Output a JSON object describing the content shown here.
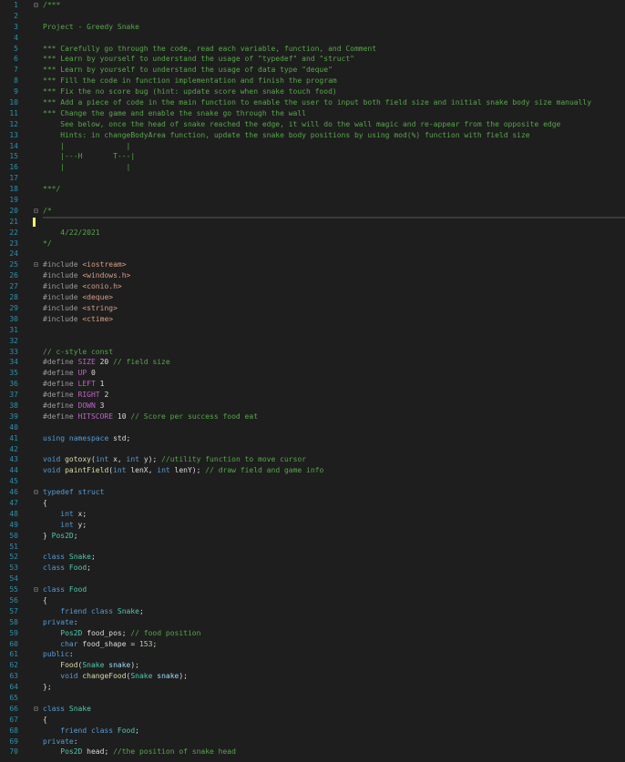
{
  "lines": [
    {
      "n": "1",
      "fold": "⊟",
      "tokens": [
        [
          "/***",
          "comment"
        ]
      ]
    },
    {
      "n": "2",
      "fold": "",
      "tokens": []
    },
    {
      "n": "3",
      "fold": "",
      "tokens": [
        [
          "Project - Greedy Snake",
          "comment"
        ]
      ]
    },
    {
      "n": "4",
      "fold": "",
      "tokens": []
    },
    {
      "n": "5",
      "fold": "",
      "tokens": [
        [
          "*** Carefully go through the code, read each variable, function, and Comment",
          "comment"
        ]
      ]
    },
    {
      "n": "6",
      "fold": "",
      "tokens": [
        [
          "*** Learn by yourself to understand the usage of \"typedef\" and \"struct\"",
          "comment"
        ]
      ]
    },
    {
      "n": "7",
      "fold": "",
      "tokens": [
        [
          "*** Learn by yourself to understand the usage of data type \"deque\"",
          "comment"
        ]
      ]
    },
    {
      "n": "8",
      "fold": "",
      "tokens": [
        [
          "*** Fill the code in function implementation and finish the program",
          "comment"
        ]
      ]
    },
    {
      "n": "9",
      "fold": "",
      "tokens": [
        [
          "*** Fix the no score bug (hint: update score when snake touch food)",
          "comment"
        ]
      ]
    },
    {
      "n": "10",
      "fold": "",
      "tokens": [
        [
          "*** Add a piece of code in the main function to enable the user to input both field size and initial snake body size manually",
          "comment"
        ]
      ]
    },
    {
      "n": "11",
      "fold": "",
      "tokens": [
        [
          "*** Change the game and enable the snake go through the wall",
          "comment"
        ]
      ]
    },
    {
      "n": "12",
      "fold": "",
      "tokens": [
        [
          "    See below, once the head of snake reached the edge, it will do the wall magic and re-appear from the opposite edge",
          "comment"
        ]
      ]
    },
    {
      "n": "13",
      "fold": "",
      "tokens": [
        [
          "    Hints: in changeBodyArea function, update the snake body positions by using mod(%) function with field size",
          "comment"
        ]
      ]
    },
    {
      "n": "14",
      "fold": "",
      "tokens": [
        [
          "    |              |",
          "comment"
        ]
      ]
    },
    {
      "n": "15",
      "fold": "",
      "tokens": [
        [
          "    |---H       T---|",
          "comment"
        ]
      ]
    },
    {
      "n": "16",
      "fold": "",
      "tokens": [
        [
          "    |              |",
          "comment"
        ]
      ]
    },
    {
      "n": "17",
      "fold": "",
      "tokens": []
    },
    {
      "n": "18",
      "fold": "",
      "tokens": [
        [
          "***/",
          "comment"
        ]
      ]
    },
    {
      "n": "19",
      "fold": "",
      "tokens": []
    },
    {
      "n": "20",
      "fold": "⊟",
      "tokens": [
        [
          "/*",
          "comment"
        ]
      ]
    },
    {
      "n": "21",
      "fold": "",
      "tokens": [],
      "current": true
    },
    {
      "n": "22",
      "fold": "",
      "tokens": [
        [
          "    4/22/2021",
          "comment"
        ]
      ]
    },
    {
      "n": "23",
      "fold": "",
      "tokens": [
        [
          "*/",
          "comment"
        ]
      ]
    },
    {
      "n": "24",
      "fold": "",
      "tokens": []
    },
    {
      "n": "25",
      "fold": "⊟",
      "tokens": [
        [
          "#include ",
          "pp"
        ],
        [
          "<iostream>",
          "string"
        ]
      ]
    },
    {
      "n": "26",
      "fold": "",
      "tokens": [
        [
          "#include ",
          "pp"
        ],
        [
          "<windows.h>",
          "string"
        ]
      ]
    },
    {
      "n": "27",
      "fold": "",
      "tokens": [
        [
          "#include ",
          "pp"
        ],
        [
          "<conio.h>",
          "string"
        ]
      ]
    },
    {
      "n": "28",
      "fold": "",
      "tokens": [
        [
          "#include ",
          "pp"
        ],
        [
          "<deque>",
          "string"
        ]
      ]
    },
    {
      "n": "29",
      "fold": "",
      "tokens": [
        [
          "#include ",
          "pp"
        ],
        [
          "<string>",
          "string"
        ]
      ]
    },
    {
      "n": "30",
      "fold": "",
      "tokens": [
        [
          "#include ",
          "pp"
        ],
        [
          "<ctime>",
          "string"
        ]
      ]
    },
    {
      "n": "31",
      "fold": "",
      "tokens": []
    },
    {
      "n": "32",
      "fold": "",
      "tokens": []
    },
    {
      "n": "33",
      "fold": "",
      "tokens": [
        [
          "// c-style const",
          "comment"
        ]
      ]
    },
    {
      "n": "34",
      "fold": "",
      "tokens": [
        [
          "#define ",
          "pp"
        ],
        [
          "SIZE",
          "macro"
        ],
        [
          " 20 ",
          "plain"
        ],
        [
          "// field size",
          "comment"
        ]
      ]
    },
    {
      "n": "35",
      "fold": "",
      "tokens": [
        [
          "#define ",
          "pp"
        ],
        [
          "UP",
          "macro"
        ],
        [
          " 0",
          "plain"
        ]
      ]
    },
    {
      "n": "36",
      "fold": "",
      "tokens": [
        [
          "#define ",
          "pp"
        ],
        [
          "LEFT",
          "macro"
        ],
        [
          " 1",
          "plain"
        ]
      ]
    },
    {
      "n": "37",
      "fold": "",
      "tokens": [
        [
          "#define ",
          "pp"
        ],
        [
          "RIGHT",
          "macro"
        ],
        [
          " 2",
          "plain"
        ]
      ]
    },
    {
      "n": "38",
      "fold": "",
      "tokens": [
        [
          "#define ",
          "pp"
        ],
        [
          "DOWN",
          "macro"
        ],
        [
          " 3",
          "plain"
        ]
      ]
    },
    {
      "n": "39",
      "fold": "",
      "tokens": [
        [
          "#define ",
          "pp"
        ],
        [
          "HITSCORE",
          "macro"
        ],
        [
          " 10 ",
          "plain"
        ],
        [
          "// Score per success food eat",
          "comment"
        ]
      ]
    },
    {
      "n": "40",
      "fold": "",
      "tokens": []
    },
    {
      "n": "41",
      "fold": "",
      "tokens": [
        [
          "using ",
          "keyword"
        ],
        [
          "namespace ",
          "keyword"
        ],
        [
          "std;",
          "plain"
        ]
      ]
    },
    {
      "n": "42",
      "fold": "",
      "tokens": []
    },
    {
      "n": "43",
      "fold": "",
      "tokens": [
        [
          "void ",
          "keyword"
        ],
        [
          "gotoxy",
          "func"
        ],
        [
          "(",
          "plain"
        ],
        [
          "int ",
          "keyword"
        ],
        [
          "x, ",
          "plain"
        ],
        [
          "int ",
          "keyword"
        ],
        [
          "y); ",
          "plain"
        ],
        [
          "//utility function to move cursor",
          "comment"
        ]
      ]
    },
    {
      "n": "44",
      "fold": "",
      "tokens": [
        [
          "void ",
          "keyword"
        ],
        [
          "paintField",
          "func"
        ],
        [
          "(",
          "plain"
        ],
        [
          "int ",
          "keyword"
        ],
        [
          "lenX, ",
          "plain"
        ],
        [
          "int ",
          "keyword"
        ],
        [
          "lenY); ",
          "plain"
        ],
        [
          "// draw field and game info",
          "comment"
        ]
      ]
    },
    {
      "n": "45",
      "fold": "",
      "tokens": []
    },
    {
      "n": "46",
      "fold": "⊟",
      "tokens": [
        [
          "typedef ",
          "keyword"
        ],
        [
          "struct",
          "keyword"
        ]
      ]
    },
    {
      "n": "47",
      "fold": "",
      "tokens": [
        [
          "{",
          "plain"
        ]
      ]
    },
    {
      "n": "48",
      "fold": "",
      "tokens": [
        [
          "    ",
          "plain"
        ],
        [
          "int ",
          "keyword"
        ],
        [
          "x;",
          "plain"
        ]
      ]
    },
    {
      "n": "49",
      "fold": "",
      "tokens": [
        [
          "    ",
          "plain"
        ],
        [
          "int ",
          "keyword"
        ],
        [
          "y;",
          "plain"
        ]
      ]
    },
    {
      "n": "50",
      "fold": "",
      "tokens": [
        [
          "} ",
          "plain"
        ],
        [
          "Pos2D",
          "type"
        ],
        [
          ";",
          "plain"
        ]
      ]
    },
    {
      "n": "51",
      "fold": "",
      "tokens": []
    },
    {
      "n": "52",
      "fold": "",
      "tokens": [
        [
          "class ",
          "keyword"
        ],
        [
          "Snake",
          "type"
        ],
        [
          ";",
          "plain"
        ]
      ]
    },
    {
      "n": "53",
      "fold": "",
      "tokens": [
        [
          "class ",
          "keyword"
        ],
        [
          "Food",
          "type"
        ],
        [
          ";",
          "plain"
        ]
      ]
    },
    {
      "n": "54",
      "fold": "",
      "tokens": []
    },
    {
      "n": "55",
      "fold": "⊟",
      "tokens": [
        [
          "class ",
          "keyword"
        ],
        [
          "Food",
          "type"
        ]
      ]
    },
    {
      "n": "56",
      "fold": "",
      "tokens": [
        [
          "{",
          "plain"
        ]
      ]
    },
    {
      "n": "57",
      "fold": "",
      "tokens": [
        [
          "    ",
          "plain"
        ],
        [
          "friend ",
          "keyword"
        ],
        [
          "class ",
          "keyword"
        ],
        [
          "Snake",
          "type"
        ],
        [
          ";",
          "plain"
        ]
      ]
    },
    {
      "n": "58",
      "fold": "",
      "tokens": [
        [
          "private",
          "keyword"
        ],
        [
          ":",
          "plain"
        ]
      ]
    },
    {
      "n": "59",
      "fold": "",
      "tokens": [
        [
          "    ",
          "plain"
        ],
        [
          "Pos2D ",
          "type"
        ],
        [
          "food_pos; ",
          "plain"
        ],
        [
          "// food position",
          "comment"
        ]
      ]
    },
    {
      "n": "60",
      "fold": "",
      "tokens": [
        [
          "    ",
          "plain"
        ],
        [
          "char ",
          "keyword"
        ],
        [
          "food_shape = ",
          "plain"
        ],
        [
          "153",
          "number"
        ],
        [
          ";",
          "plain"
        ]
      ]
    },
    {
      "n": "61",
      "fold": "",
      "tokens": [
        [
          "public",
          "keyword"
        ],
        [
          ":",
          "plain"
        ]
      ]
    },
    {
      "n": "62",
      "fold": "",
      "tokens": [
        [
          "    ",
          "plain"
        ],
        [
          "Food",
          "func"
        ],
        [
          "(",
          "plain"
        ],
        [
          "Snake ",
          "type"
        ],
        [
          "snake",
          "param"
        ],
        [
          ");",
          "plain"
        ]
      ]
    },
    {
      "n": "63",
      "fold": "",
      "tokens": [
        [
          "    ",
          "plain"
        ],
        [
          "void ",
          "keyword"
        ],
        [
          "changeFood",
          "func"
        ],
        [
          "(",
          "plain"
        ],
        [
          "Snake ",
          "type"
        ],
        [
          "snake",
          "param"
        ],
        [
          ");",
          "plain"
        ]
      ]
    },
    {
      "n": "64",
      "fold": "",
      "tokens": [
        [
          "};",
          "plain"
        ]
      ]
    },
    {
      "n": "65",
      "fold": "",
      "tokens": []
    },
    {
      "n": "66",
      "fold": "⊟",
      "tokens": [
        [
          "class ",
          "keyword"
        ],
        [
          "Snake",
          "type"
        ]
      ]
    },
    {
      "n": "67",
      "fold": "",
      "tokens": [
        [
          "{",
          "plain"
        ]
      ]
    },
    {
      "n": "68",
      "fold": "",
      "tokens": [
        [
          "    ",
          "plain"
        ],
        [
          "friend ",
          "keyword"
        ],
        [
          "class ",
          "keyword"
        ],
        [
          "Food",
          "type"
        ],
        [
          ";",
          "plain"
        ]
      ]
    },
    {
      "n": "69",
      "fold": "",
      "tokens": [
        [
          "private",
          "keyword"
        ],
        [
          ":",
          "plain"
        ]
      ]
    },
    {
      "n": "70",
      "fold": "",
      "tokens": [
        [
          "    ",
          "plain"
        ],
        [
          "Pos2D ",
          "type"
        ],
        [
          "head; ",
          "plain"
        ],
        [
          "//the position of snake head",
          "comment"
        ]
      ]
    }
  ]
}
